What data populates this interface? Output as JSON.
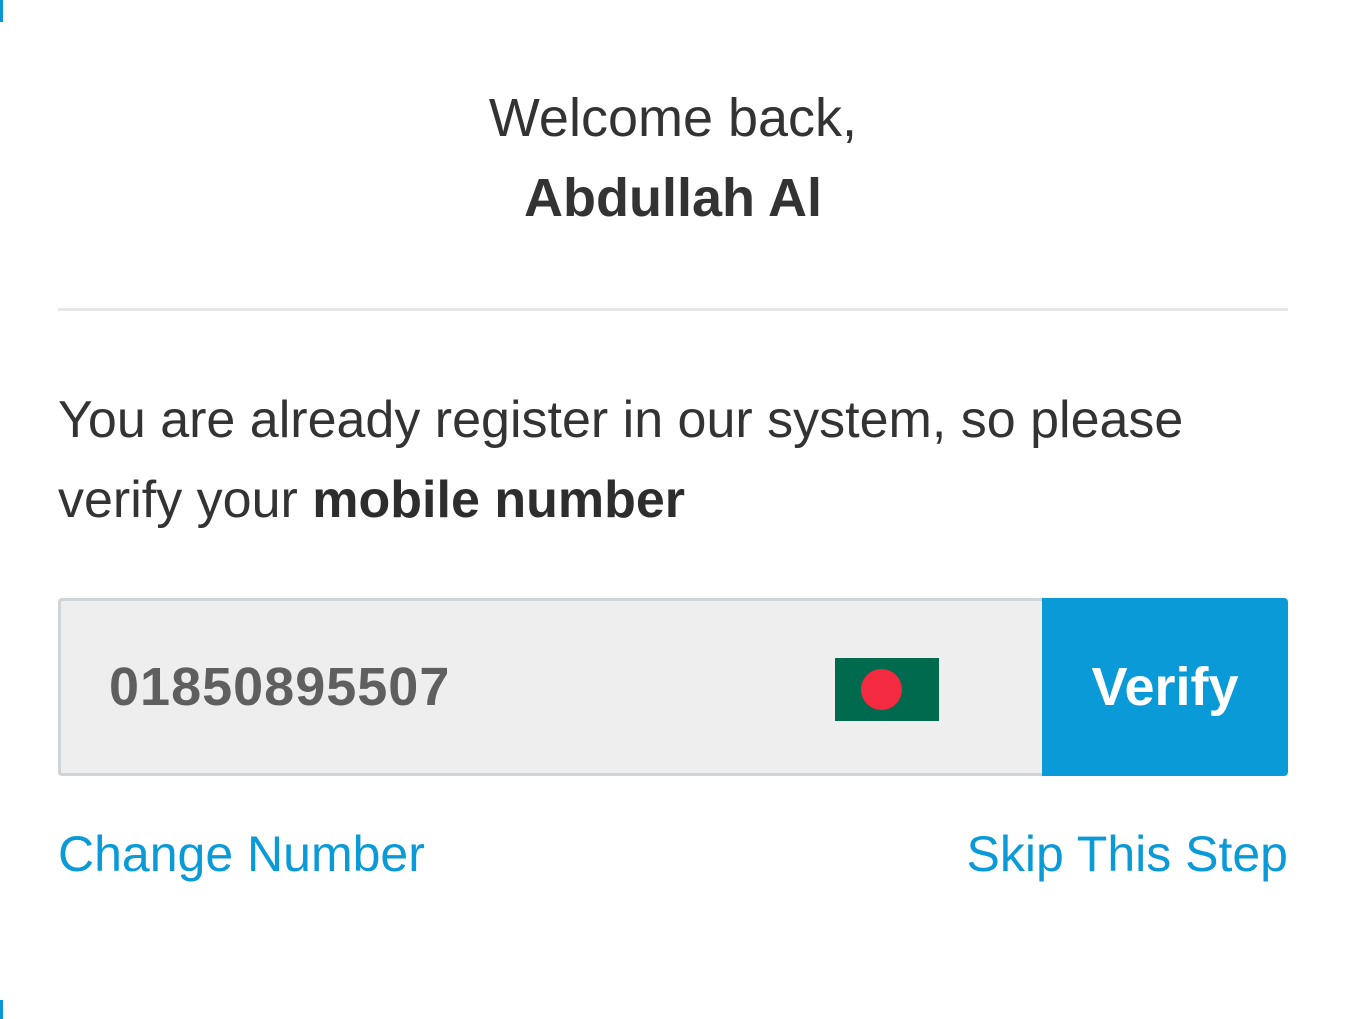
{
  "header": {
    "greeting": "Welcome back,",
    "user_name": "Abdullah Al"
  },
  "message": {
    "text": "You are already register in our system, so please verify your ",
    "emphasis": "mobile number"
  },
  "phone": {
    "value": "01850895507",
    "country_flag": "bangladesh-flag-icon"
  },
  "actions": {
    "verify_label": "Verify",
    "change_number_label": "Change Number",
    "skip_label": "Skip This Step"
  },
  "colors": {
    "accent": "#0a9ad8",
    "flag_green": "#006a4e",
    "flag_red": "#f42a41"
  }
}
